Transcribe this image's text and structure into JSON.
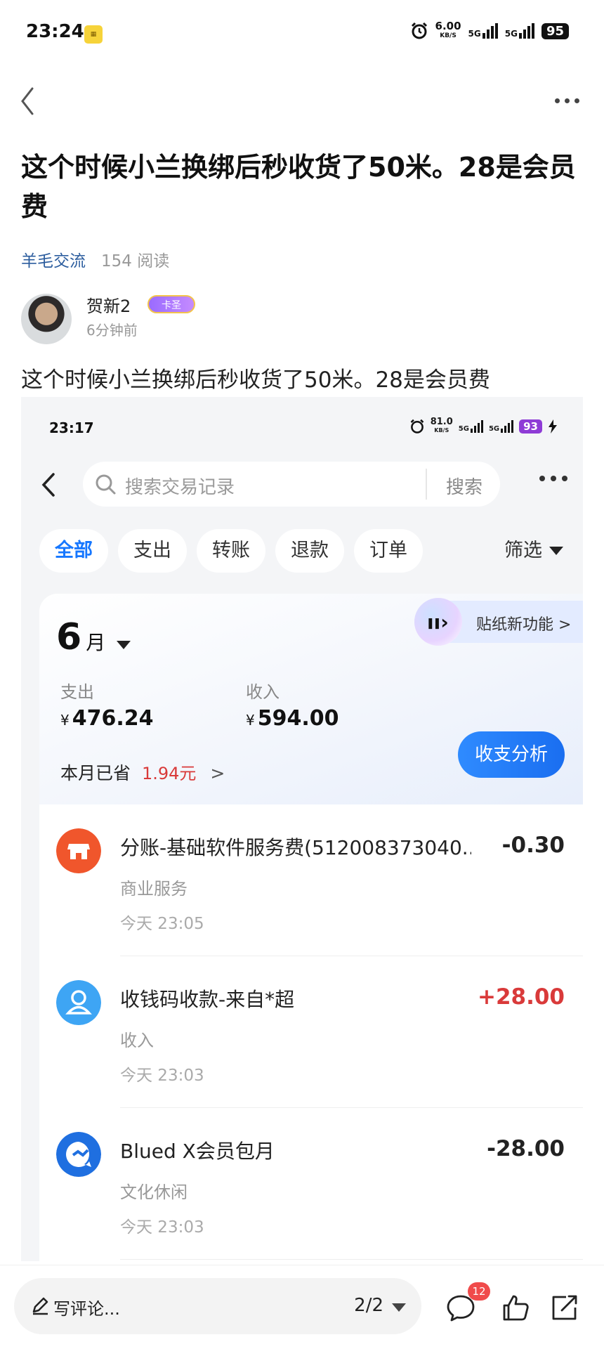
{
  "status_bar": {
    "time": "23:24",
    "speed_value": "6.00",
    "speed_unit": "KB/S",
    "network1": "5G",
    "network2": "5G",
    "battery": "95"
  },
  "post": {
    "title": "这个时候小兰换绑后秒收货了50米。28是会员费",
    "category": "羊毛交流",
    "reads": "154 阅读",
    "author_name": "贺新2",
    "author_badge": "卡圣",
    "author_time": "6分钟前",
    "body": "这个时候小兰换绑后秒收货了50米。28是会员费"
  },
  "screenshot": {
    "status": {
      "time": "23:17",
      "speed_value": "81.0",
      "speed_unit": "KB/S",
      "network1": "5G",
      "network2": "5G",
      "battery": "93"
    },
    "search": {
      "placeholder": "搜索交易记录",
      "button": "搜索"
    },
    "chips": [
      "全部",
      "支出",
      "转账",
      "退款",
      "订单"
    ],
    "filter_label": "筛选",
    "month": "6",
    "month_unit": "月",
    "sticker_label": "贴纸新功能 >",
    "expense_label": "支出",
    "expense_currency": "¥",
    "expense_value": "476.24",
    "income_label": "收入",
    "income_currency": "¥",
    "income_value": "594.00",
    "saved_label": "本月已省",
    "saved_value": "1.94元",
    "saved_chevron": ">",
    "analysis_button": "收支分析",
    "transactions": [
      {
        "title": "分账-基础软件服务费(512008373040...",
        "amount": "-0.30",
        "category": "商业服务",
        "time": "今天 23:05",
        "icon": "store-icon",
        "color": "#f0562c"
      },
      {
        "title": "收钱码收款-来自*超",
        "amount": "+28.00",
        "category": "收入",
        "time": "今天 23:03",
        "icon": "person-icon",
        "color": "#3ea5f4"
      },
      {
        "title": "Blued X会员包月",
        "amount": "-28.00",
        "category": "文化休闲",
        "time": "今天 23:03",
        "icon": "blued-icon",
        "color": "#1f6fe0"
      }
    ]
  },
  "bottom_bar": {
    "comment_placeholder": "写评论...",
    "page_indicator": "2/2",
    "comment_count": "12"
  },
  "colors": {
    "accent": "#1677ff",
    "income_red": "#d93a3a",
    "category_link": "#2c5d9e"
  }
}
